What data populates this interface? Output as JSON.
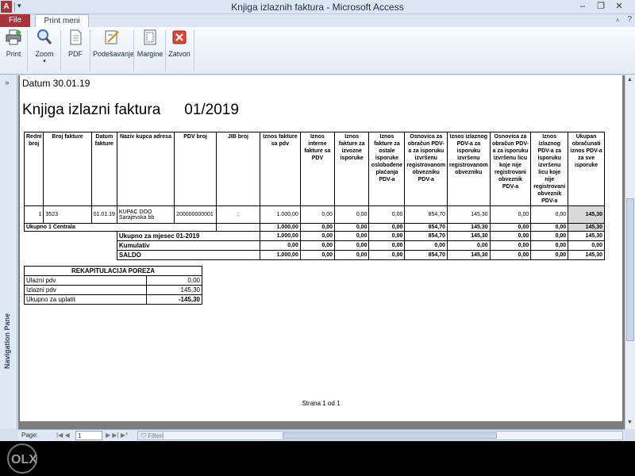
{
  "window": {
    "title": "Knjiga izlaznih faktura - Microsoft Access"
  },
  "tabs": {
    "file": "File",
    "print_preview": "Print meni"
  },
  "ribbon": {
    "print": "Print",
    "zoom": "Zoom",
    "pdf": "PDF",
    "setup": "Podešavanje",
    "margins": "Margine",
    "close": "Zatvori"
  },
  "nav_pane": {
    "label": "Navigation Pane"
  },
  "report": {
    "datum": "Datum  30.01.19",
    "title_left": "Knjiga izlazni faktura",
    "title_right": "01/2019",
    "headers": [
      "Redni broj",
      "Broj fakture",
      "Datum fakture",
      "Naziv kupca adresa",
      "PDV broj",
      "JIB broj",
      "Iznos fakture sa pdv",
      "Iznos interne fakture sa PDV",
      "Iznos fakture za izvozne isporuke",
      "Iznos fakture za ostale isporuke oslobođene plaćanja PDV-a",
      "Osnovica za obračun PDV-a za isporuku izvršenu registrovanom obvezniku PDV-a",
      "Iznos izlaznog PDV-a za isporuku izvršenu registrovanom obvezniku",
      "Osnovica za obračun PDV-a za isporuku izvršenu licu koje nije registrovani obveznik PDV-a",
      "Iznos izlaznog PDV-a za isporuku izvršenu licu koje nije registrovani obveznik PDV-a",
      "Ukupan obračunati iznos PDV-a za sve isporuke"
    ],
    "row": {
      "redni": "1",
      "broj": "3523",
      "datum": "01.01.19",
      "kupac": "KUPAC DOO Sarajevska bb",
      "pdv": "200000000001",
      "jib": ";",
      "v": [
        "1.000,00",
        "0,00",
        "0,00",
        "0,00",
        "854,70",
        "145,30",
        "0,00",
        "0,00",
        "145,30"
      ]
    },
    "ukupno_centrala": {
      "label": "Ukupno 1 Centrala",
      "v": [
        "1.000,00",
        "0,00",
        "0,00",
        "0,00",
        "854,70",
        "145,30",
        "0,00",
        "0,00",
        "145,30"
      ]
    },
    "summary": [
      {
        "label": "Ukupno za mjesec 01-2019",
        "v": [
          "1.000,00",
          "0,00",
          "0,00",
          "0,00",
          "854,70",
          "145,30",
          "0,00",
          "0,00",
          "145,30"
        ]
      },
      {
        "label": "Kumulativ",
        "v": [
          "0,00",
          "0,00",
          "0,00",
          "0,00",
          "0,00",
          "0,00",
          "0,00",
          "0,00",
          "0,00"
        ]
      },
      {
        "label": "SALDO",
        "v": [
          "1.000,00",
          "0,00",
          "0,00",
          "0,00",
          "854,70",
          "145,30",
          "0,00",
          "0,00",
          "145,30"
        ]
      }
    ],
    "recap": {
      "title": "REKAPITULACIJA POREZA",
      "rows": [
        {
          "label": "Ulazni pdv",
          "value": "0,00"
        },
        {
          "label": "Izlazni pdv",
          "value": "145,30"
        },
        {
          "label": "Ukupno za uplatit",
          "value": "-145,30"
        }
      ]
    },
    "page_footer": "Strana 1 od 1"
  },
  "status": {
    "page_label": "Page:",
    "page_value": "1",
    "filter": "Filtered"
  }
}
